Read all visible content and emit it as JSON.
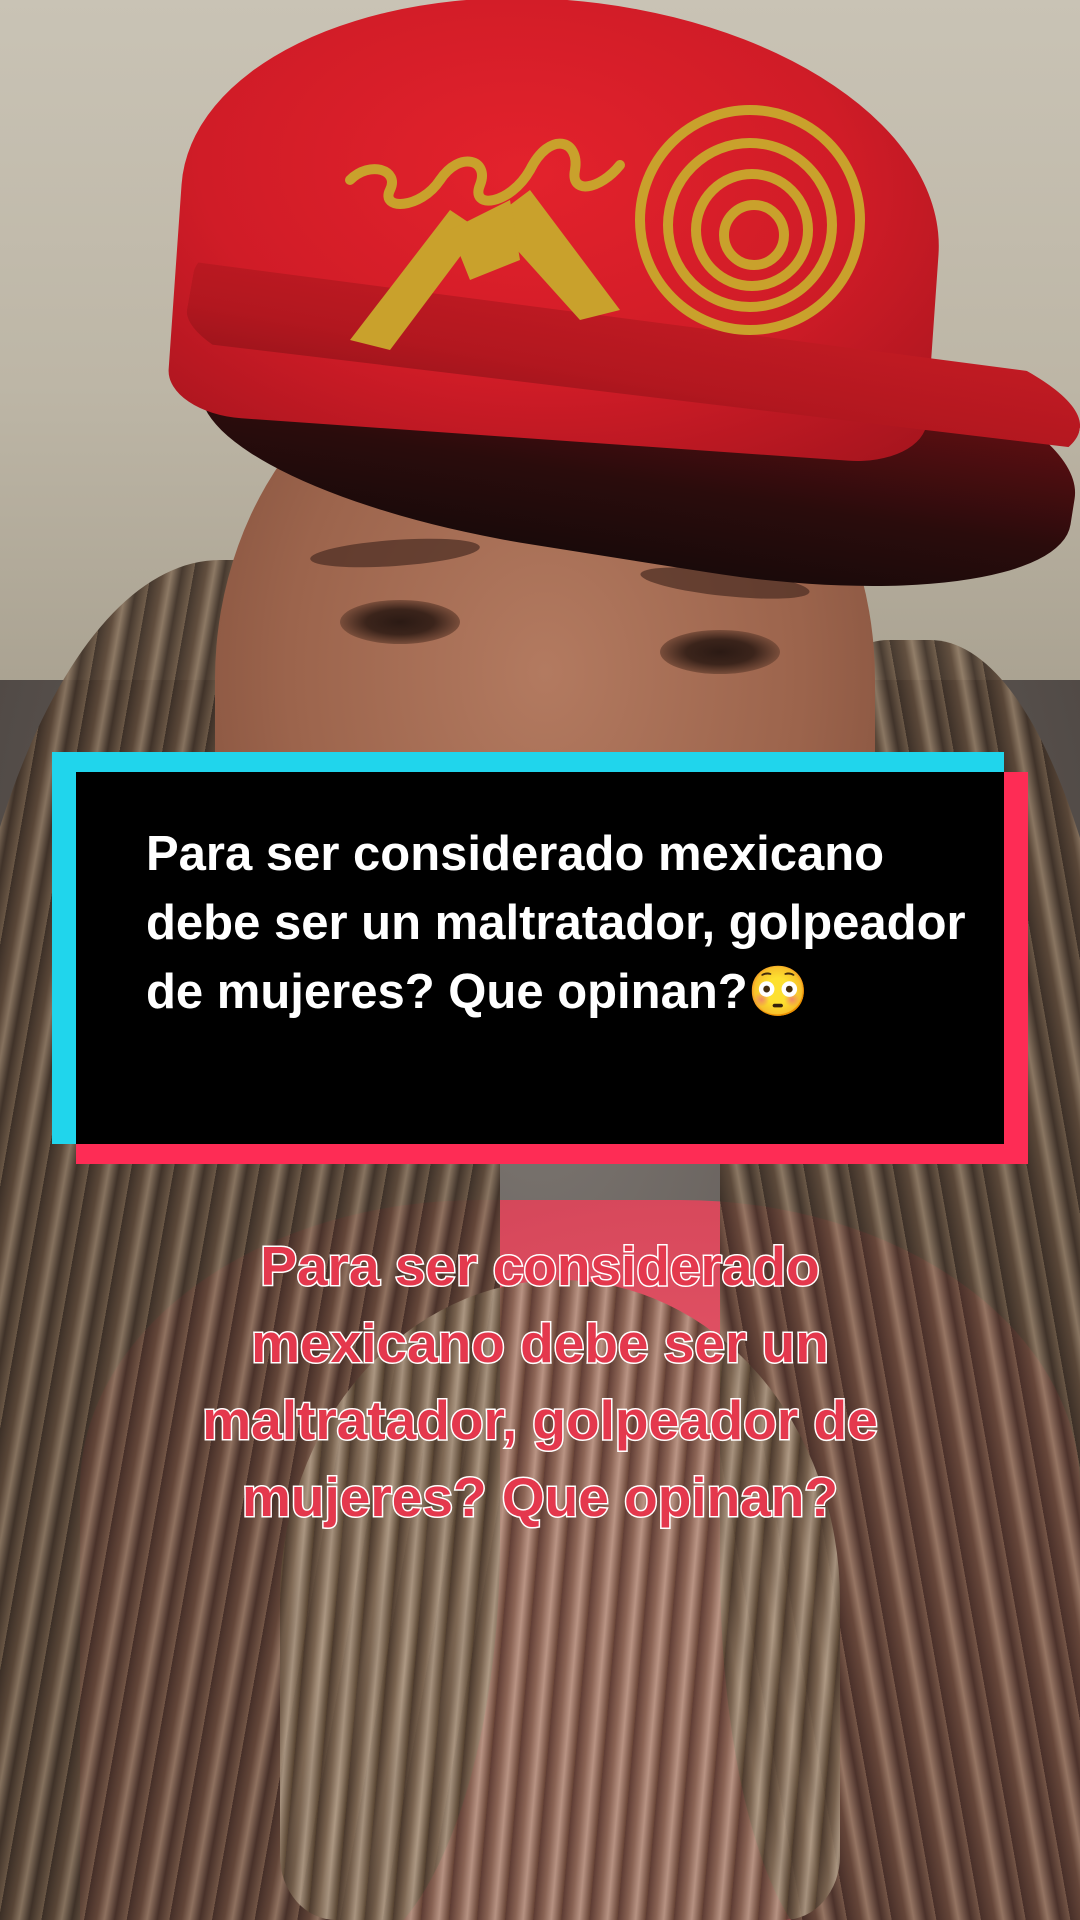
{
  "overlay": {
    "question_text": "Para ser considerado mexicano debe ser un maltratador, golpeador de mujeres? Que opinan?😳",
    "colors": {
      "box_background": "#000000",
      "box_shadow_cyan": "#20d5ec",
      "box_shadow_red": "#fe2c55",
      "text": "#ffffff"
    }
  },
  "caption": {
    "text": "Para ser considerado mexicano debe ser un maltratador, golpeador de mujeres? Que opinan?",
    "colors": {
      "fill": "#e4384d",
      "outline": "#ffffff"
    }
  },
  "photo": {
    "icons": [
      "person-selfie",
      "red-cap-with-gold-embroidery"
    ],
    "colors": {
      "cap": "#d01c27",
      "embroidery": "#c9a12c",
      "shirt": "#d8495c"
    }
  }
}
